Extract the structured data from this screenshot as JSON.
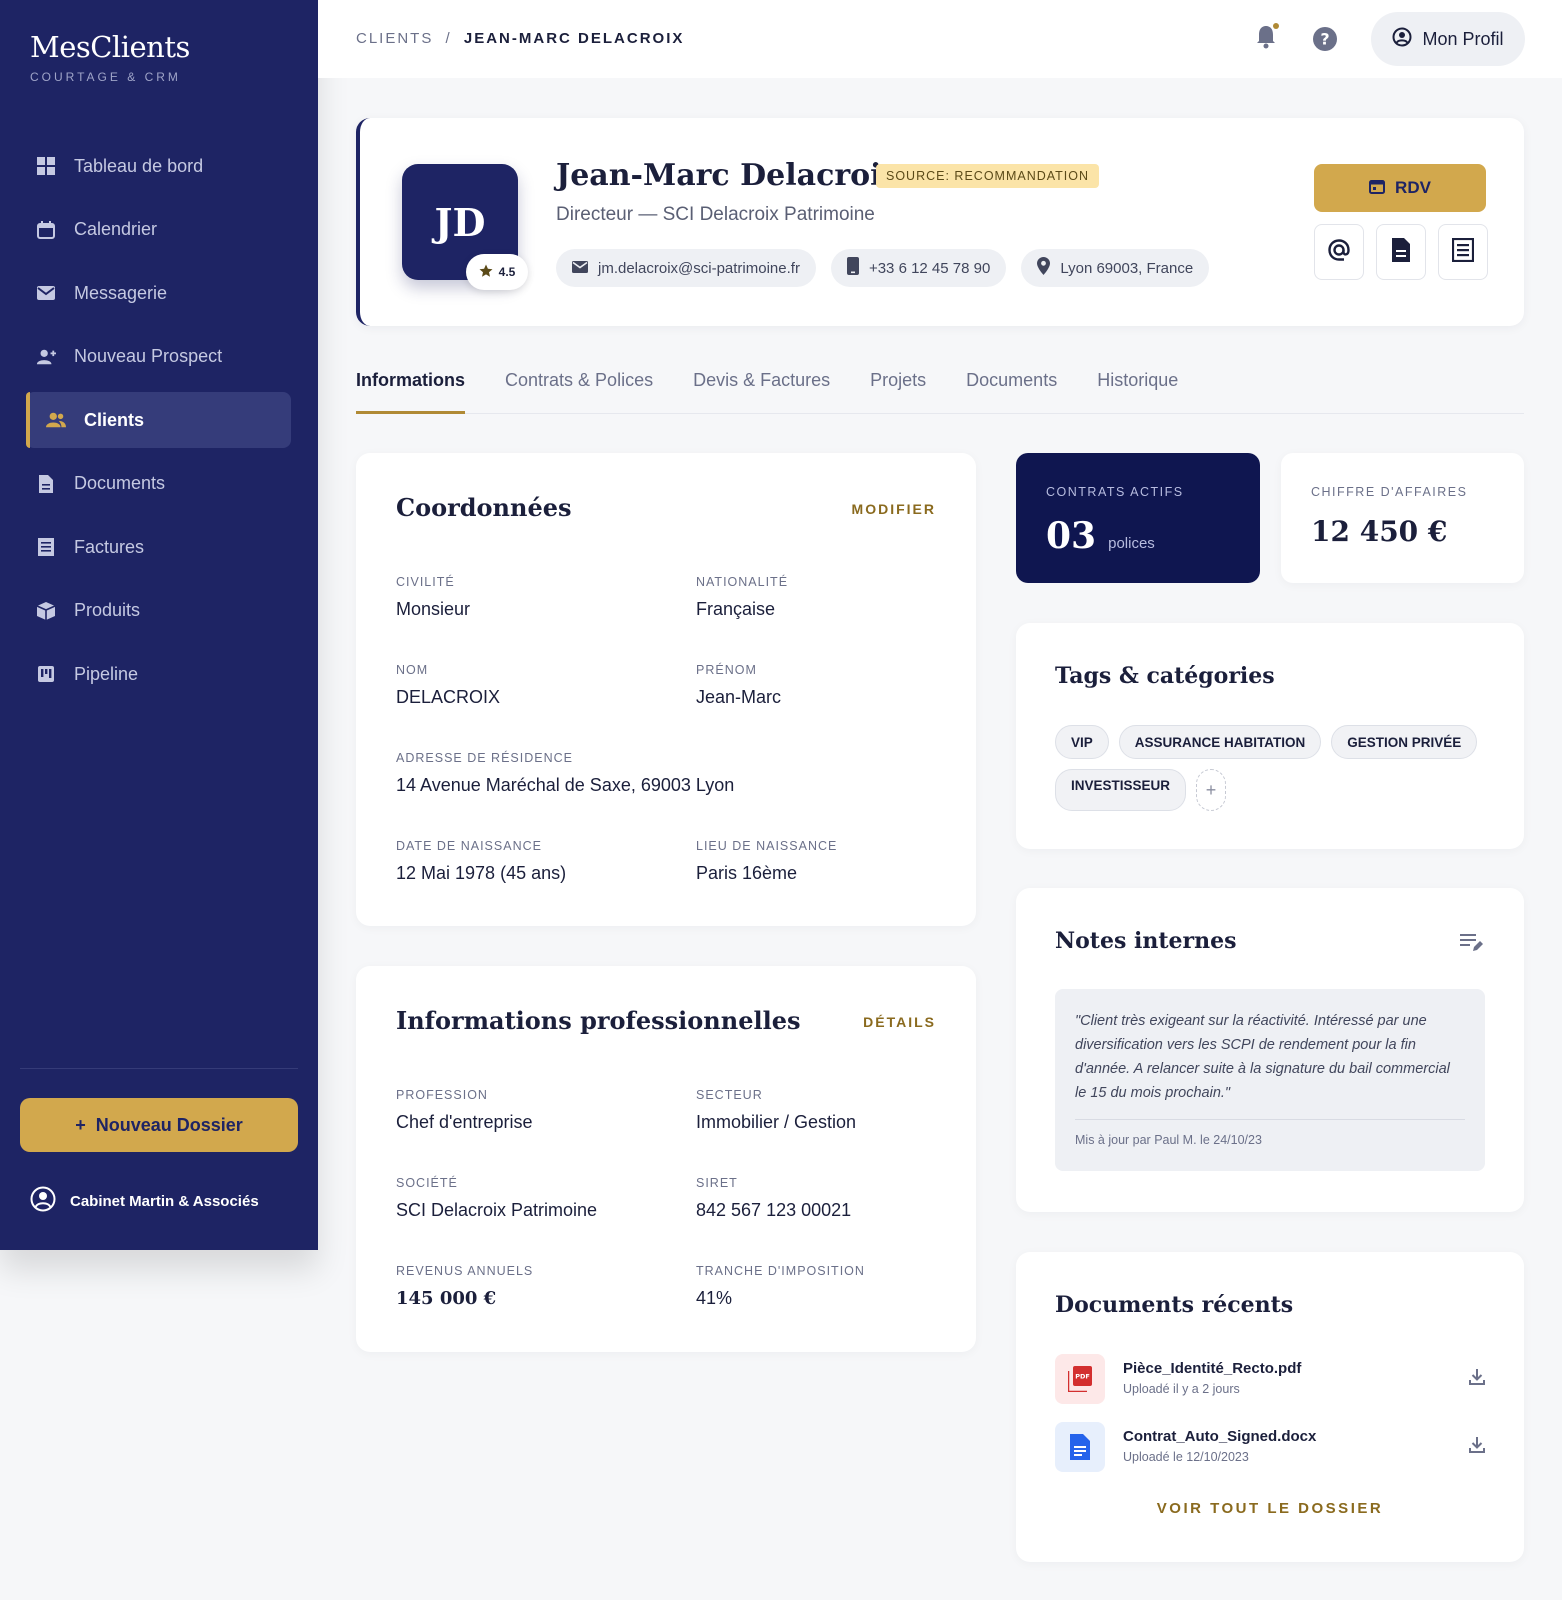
{
  "brand": {
    "title": "MesClients",
    "subtitle": "COURTAGE & CRM"
  },
  "sidebar": {
    "items": [
      {
        "label": "Tableau de bord",
        "icon": "dashboard-icon"
      },
      {
        "label": "Calendrier",
        "icon": "calendar-icon"
      },
      {
        "label": "Messagerie",
        "icon": "mail-icon"
      },
      {
        "label": "Nouveau Prospect",
        "icon": "add-person-icon"
      },
      {
        "label": "Clients",
        "icon": "group-icon",
        "active": true
      },
      {
        "label": "Documents",
        "icon": "document-icon"
      },
      {
        "label": "Factures",
        "icon": "receipt-icon"
      },
      {
        "label": "Produits",
        "icon": "package-icon"
      },
      {
        "label": "Pipeline",
        "icon": "kanban-icon"
      }
    ],
    "new_dossier": "Nouveau Dossier",
    "new_dossier_plus": "+",
    "cabinet": "Cabinet Martin & Associés"
  },
  "topbar": {
    "crumb_root": "CLIENTS",
    "crumb_sep": "/",
    "crumb_current": "JEAN-MARC DELACROIX",
    "profile_label": "Mon Profil"
  },
  "client": {
    "initials": "JD",
    "rating": "4.5",
    "name": "Jean-Marc Delacroix",
    "source": "SOURCE: RECOMMANDATION",
    "role": "Directeur — SCI Delacroix Patrimoine",
    "email": "jm.delacroix@sci-patrimoine.fr",
    "phone": "+33 6 12 45 78 90",
    "location": "Lyon 69003, France",
    "rdv_label": "RDV"
  },
  "tabs": [
    "Informations",
    "Contrats & Polices",
    "Devis & Factures",
    "Projets",
    "Documents",
    "Historique"
  ],
  "coordonnees": {
    "title": "Coordonnées",
    "action": "MODIFIER",
    "fields": {
      "civilite": {
        "label": "CIVILITÉ",
        "value": "Monsieur"
      },
      "nationalite": {
        "label": "NATIONALITÉ",
        "value": "Française"
      },
      "nom": {
        "label": "NOM",
        "value": "DELACROIX"
      },
      "prenom": {
        "label": "PRÉNOM",
        "value": "Jean-Marc"
      },
      "adresse": {
        "label": "ADRESSE DE RÉSIDENCE",
        "value": "14 Avenue Maréchal de Saxe, 69003 Lyon"
      },
      "naissance": {
        "label": "DATE DE NAISSANCE",
        "value": "12 Mai 1978 (45 ans)"
      },
      "lieu": {
        "label": "LIEU DE NAISSANCE",
        "value": "Paris 16ème"
      }
    }
  },
  "pro": {
    "title": "Informations professionnelles",
    "action": "DÉTAILS",
    "fields": {
      "profession": {
        "label": "PROFESSION",
        "value": "Chef d'entreprise"
      },
      "secteur": {
        "label": "SECTEUR",
        "value": "Immobilier / Gestion"
      },
      "societe": {
        "label": "SOCIÉTÉ",
        "value": "SCI Delacroix Patrimoine"
      },
      "siret": {
        "label": "SIRET",
        "value": "842 567 123 00021"
      },
      "revenus": {
        "label": "REVENUS ANNUELS",
        "value": "145 000 €"
      },
      "tranche": {
        "label": "TRANCHE D'IMPOSITION",
        "value": "41%"
      }
    }
  },
  "stats": {
    "contrats_label": "CONTRATS ACTIFS",
    "contrats_value": "03",
    "contrats_unit": "polices",
    "ca_label": "CHIFFRE D'AFFAIRES",
    "ca_value": "12 450 €"
  },
  "tags": {
    "title": "Tags & catégories",
    "items": [
      "VIP",
      "ASSURANCE HABITATION",
      "GESTION PRIVÉE",
      "INVESTISSEUR"
    ],
    "add": "+"
  },
  "notes": {
    "title": "Notes internes",
    "text": "\"Client très exigeant sur la réactivité. Intéressé par une diversification vers les SCPI de rendement pour la fin d'année. A relancer suite à la signature du bail commercial le 15 du mois prochain.\"",
    "meta": "Mis à jour par Paul M. le 24/10/23"
  },
  "documents": {
    "title": "Documents récents",
    "items": [
      {
        "name": "Pièce_Identité_Recto.pdf",
        "sub": "Uploadé il y a 2 jours",
        "icon": "pdf-icon"
      },
      {
        "name": "Contrat_Auto_Signed.docx",
        "sub": "Uploadé le 12/10/2023",
        "icon": "doc-file-icon"
      }
    ],
    "see_all": "VOIR TOUT LE DOSSIER"
  },
  "colors": {
    "navy": "#1e2464",
    "dark_navy": "#0f1650",
    "gold": "#d2a84d",
    "gold_text": "#8a6a1e",
    "source_bg": "#fbe4a8"
  }
}
